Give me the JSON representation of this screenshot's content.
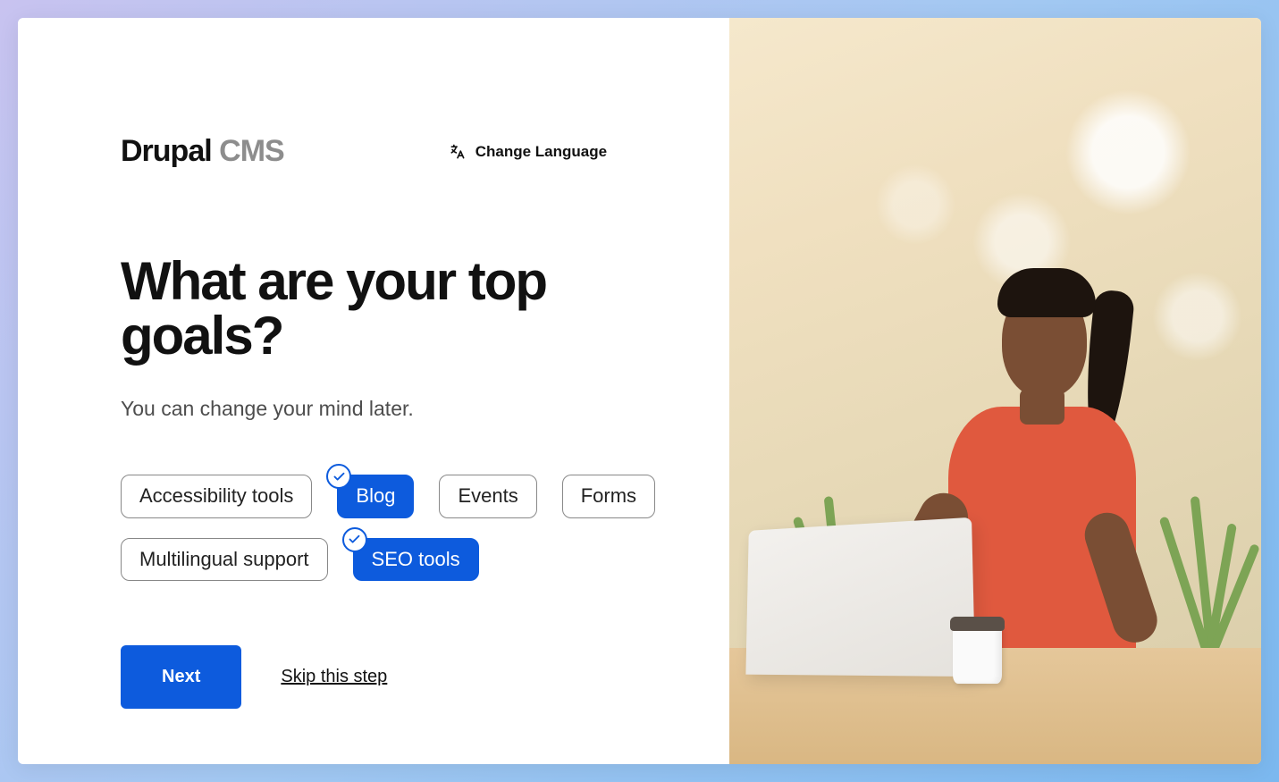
{
  "logo": {
    "brand": "Drupal",
    "suffix": "CMS"
  },
  "language_button": "Change Language",
  "title": "What are your top goals?",
  "subtitle": "You can change your mind later.",
  "goals": [
    {
      "label": "Accessibility tools",
      "selected": false
    },
    {
      "label": "Blog",
      "selected": true
    },
    {
      "label": "Events",
      "selected": false
    },
    {
      "label": "Forms",
      "selected": false
    },
    {
      "label": "Multilingual support",
      "selected": false
    },
    {
      "label": "SEO tools",
      "selected": true
    }
  ],
  "actions": {
    "next": "Next",
    "skip": "Skip this step"
  }
}
